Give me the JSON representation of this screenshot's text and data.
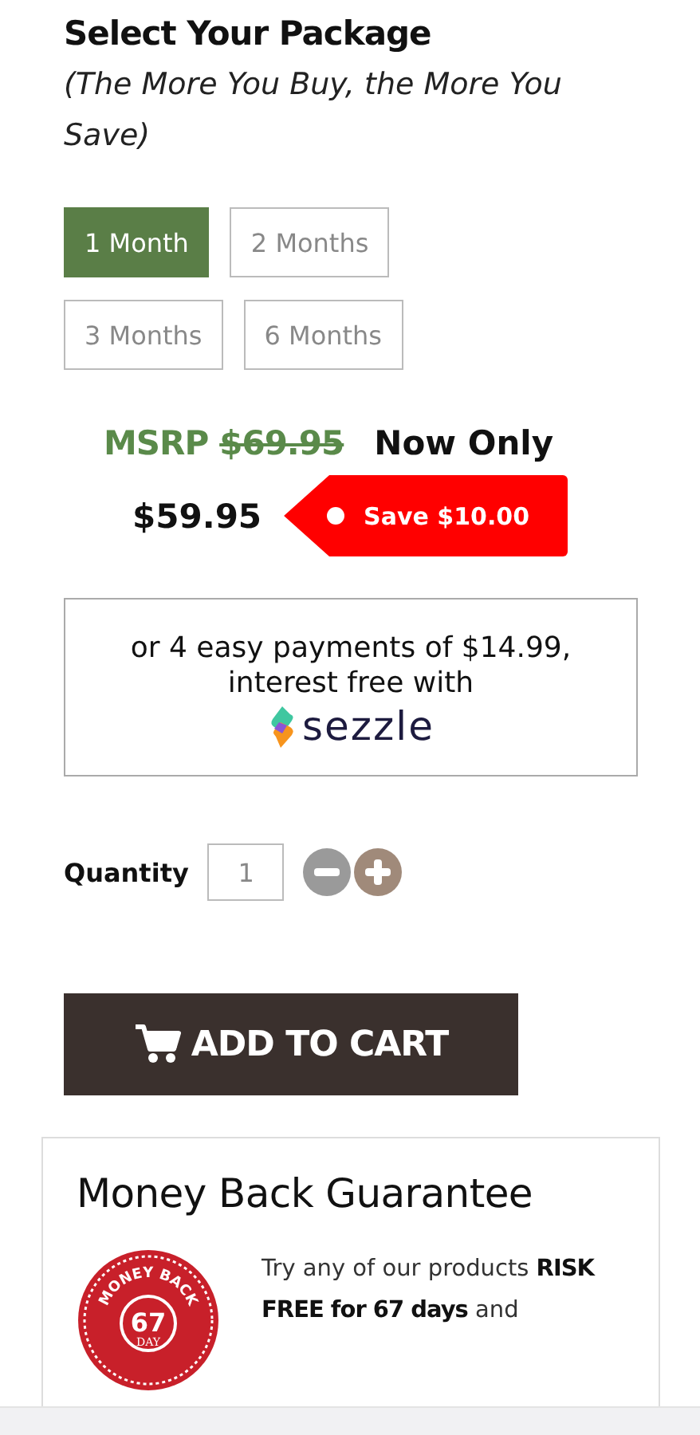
{
  "heading": "Select Your Package",
  "subheading": "(The More You Buy, the More You Save)",
  "packages": [
    {
      "label": "1 Month",
      "selected": true
    },
    {
      "label": "2 Months",
      "selected": false
    },
    {
      "label": "3 Months",
      "selected": false
    },
    {
      "label": "6 Months",
      "selected": false
    }
  ],
  "price": {
    "msrp_label": "MSRP",
    "msrp": "$69.95",
    "now_label": "Now Only",
    "price": "$59.95",
    "save": "Save $10.00"
  },
  "installments": {
    "text": "or 4 easy payments of $14.99, interest free with",
    "brand": "sezzle"
  },
  "quantity": {
    "label": "Quantity",
    "value": "1"
  },
  "add_to_cart": "ADD TO CART",
  "guarantee": {
    "title": "Money Back Guarantee",
    "badge": {
      "arc": "MONEY BACK",
      "number": "67",
      "unit": "DAY"
    },
    "text": "Try any of our products **RISK FREE for 67 days** and"
  }
}
